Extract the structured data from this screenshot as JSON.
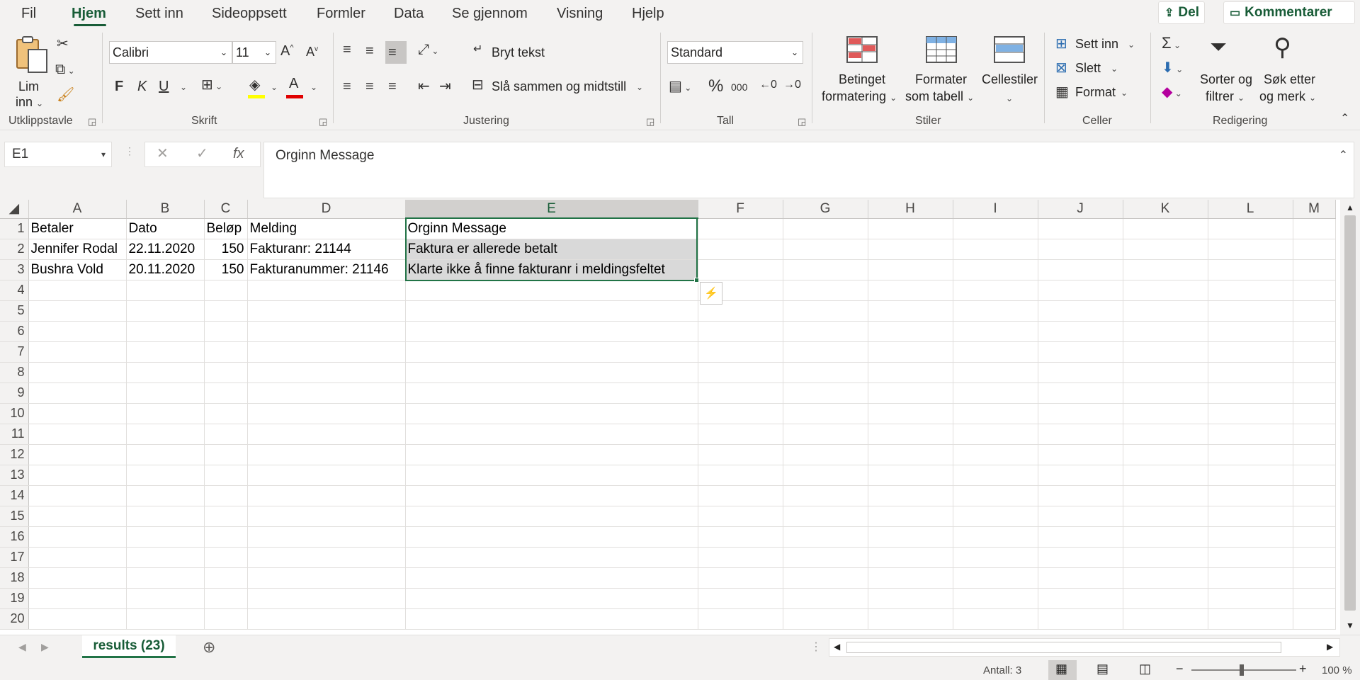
{
  "menu": {
    "tabs": [
      "Fil",
      "Hjem",
      "Sett inn",
      "Sideoppsett",
      "Formler",
      "Data",
      "Se gjennom",
      "Visning",
      "Hjelp"
    ],
    "share_label": "Del",
    "comments_label": "Kommentarer"
  },
  "ribbon": {
    "clipboard": {
      "paste_label_1": "Lim",
      "paste_label_2": "inn",
      "group_label": "Utklippstavle"
    },
    "font": {
      "font_name": "Calibri",
      "font_size": "11",
      "bold": "F",
      "italic": "K",
      "underline": "U",
      "group_label": "Skrift"
    },
    "alignment": {
      "wrap_text": "Bryt tekst",
      "merge_center": "Slå sammen og midtstill",
      "group_label": "Justering"
    },
    "number": {
      "format": "Standard",
      "percent": "%",
      "thousands": "000",
      "group_label": "Tall"
    },
    "styles": {
      "conditional_1": "Betinget",
      "conditional_2": "formatering",
      "table_1": "Formater",
      "table_2": "som tabell",
      "cell_styles": "Cellestiler",
      "group_label": "Stiler"
    },
    "cells": {
      "insert": "Sett inn",
      "delete": "Slett",
      "format": "Format",
      "group_label": "Celler"
    },
    "editing": {
      "sort_1": "Sorter og",
      "sort_2": "filtrer",
      "find_1": "Søk etter",
      "find_2": "og merk",
      "group_label": "Redigering"
    }
  },
  "formula_bar": {
    "name_box": "E1",
    "formula": "Orginn Message",
    "fx": "fx"
  },
  "sheet": {
    "columns": [
      "A",
      "B",
      "C",
      "D",
      "E",
      "F",
      "G",
      "H",
      "I",
      "J",
      "K",
      "L",
      "M"
    ],
    "rows": [
      [
        "Betaler",
        "Dato",
        "Beløp",
        "Melding",
        "Orginn Message"
      ],
      [
        "Jennifer Rodal",
        "22.11.2020",
        "150",
        "Fakturanr: 21144",
        "Faktura er allerede betalt"
      ],
      [
        "Bushra Vold",
        "20.11.2020",
        "150",
        "Fakturanummer: 21146",
        "Klarte ikke å finne fakturanr i meldingsfeltet"
      ]
    ],
    "row_numbers": [
      "1",
      "2",
      "3",
      "4",
      "5",
      "6",
      "7",
      "8",
      "9",
      "10",
      "11",
      "12",
      "13",
      "14",
      "15",
      "16",
      "17",
      "18",
      "19",
      "20"
    ],
    "selected_column": "E"
  },
  "sheet_tabs": {
    "active": "results (23)"
  },
  "status": {
    "count": "Antall: 3",
    "zoom": "100 %"
  }
}
